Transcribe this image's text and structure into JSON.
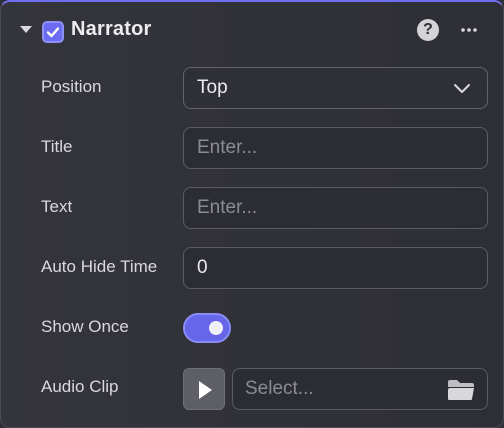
{
  "header": {
    "title": "Narrator",
    "enabled": true,
    "help_glyph": "?",
    "icons": [
      "collapse-arrow-icon",
      "checkbox-checked-icon",
      "help-icon",
      "more-options-icon"
    ]
  },
  "fields": {
    "position": {
      "label": "Position",
      "value": "Top"
    },
    "title": {
      "label": "Title",
      "placeholder": "Enter..."
    },
    "text": {
      "label": "Text",
      "placeholder": "Enter..."
    },
    "auto_hide_time": {
      "label": "Auto Hide Time",
      "value": "0"
    },
    "show_once": {
      "label": "Show Once",
      "on": true
    },
    "audio_clip": {
      "label": "Audio Clip",
      "placeholder": "Select...",
      "icons": [
        "play-icon",
        "folder-icon"
      ]
    }
  },
  "colors": {
    "accent": "#6c6cf2",
    "panel_bg": "#313238",
    "field_border": "#5a5b64",
    "text": "#d8d8de",
    "placeholder": "#8b8c94"
  }
}
